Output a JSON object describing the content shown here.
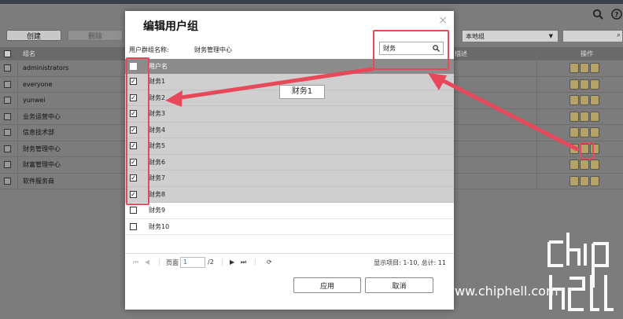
{
  "background": {
    "toolbar": {
      "create_label": "创建",
      "delete_label": "删除",
      "domain_select": "本地组"
    },
    "table": {
      "col_name": "组名",
      "col_ops": "操作",
      "col_desc": "描述",
      "rows": [
        {
          "name": "administrators"
        },
        {
          "name": "everyone"
        },
        {
          "name": "yunwei"
        },
        {
          "name": "业务运营中心"
        },
        {
          "name": "信息技术部"
        },
        {
          "name": "财务管理中心"
        },
        {
          "name": "财富管理中心"
        },
        {
          "name": "软件服务商"
        }
      ]
    }
  },
  "dialog": {
    "title": "编辑用户组",
    "close_icon": "×",
    "group_name_label": "用户群组名称:",
    "group_name_value": "财务管理中心",
    "search_value": "财务",
    "list_header": "用户名",
    "users": [
      {
        "name": "财务1",
        "checked": true
      },
      {
        "name": "财务2",
        "checked": true
      },
      {
        "name": "财务3",
        "checked": true
      },
      {
        "name": "财务4",
        "checked": true
      },
      {
        "name": "财务5",
        "checked": true
      },
      {
        "name": "财务6",
        "checked": true
      },
      {
        "name": "财务7",
        "checked": true
      },
      {
        "name": "财务8",
        "checked": true
      },
      {
        "name": "财务9",
        "checked": false
      },
      {
        "name": "财务10",
        "checked": false
      }
    ],
    "tooltip": "财务1",
    "pager": {
      "page_label": "页面",
      "page_value": "1",
      "total_pages": "/2",
      "summary": "显示项目: 1-10, 总计: 11"
    },
    "apply_label": "应用",
    "cancel_label": "取消"
  },
  "watermark": "www.chiphell.com",
  "colors": {
    "annotation_red": "#e8495a",
    "selected_row": "#cfcfcf",
    "list_header": "#8c8c8c"
  }
}
